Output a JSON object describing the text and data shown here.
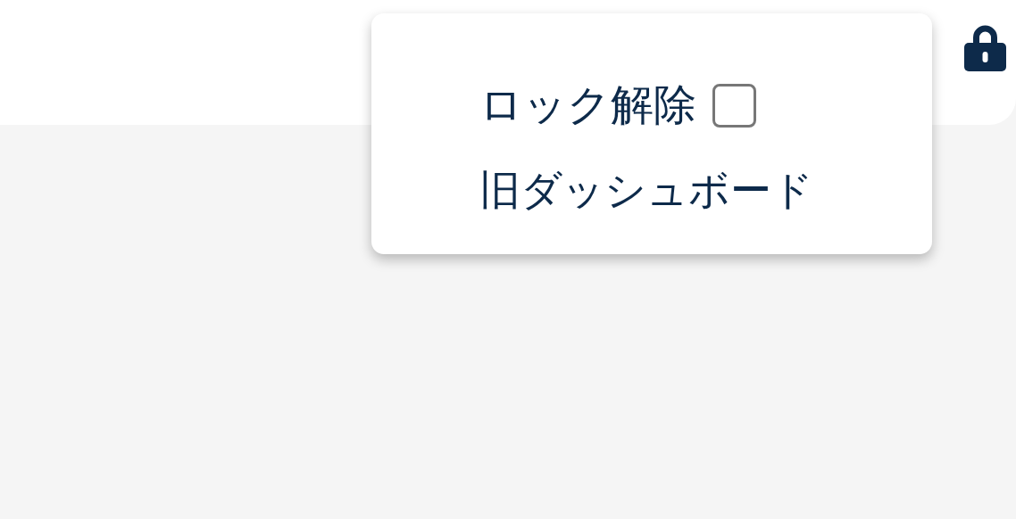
{
  "menu": {
    "items": [
      {
        "kind": "checkbox",
        "label": "ロック解除",
        "checked": false
      },
      {
        "kind": "link",
        "label": "旧ダッシュボード"
      }
    ]
  }
}
